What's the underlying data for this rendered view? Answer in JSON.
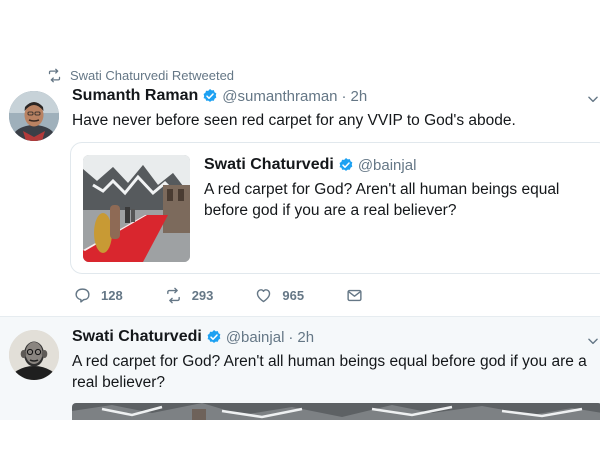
{
  "retweet_context": {
    "icon": "retweet-icon",
    "label": "Swati Chaturvedi Retweeted"
  },
  "tweet1": {
    "author_name": "Sumanth Raman",
    "handle": "@sumanthraman",
    "separator": "·",
    "time": "2h",
    "text": "Have never before seen red carpet for any VVIP to God's abode.",
    "quote": {
      "author_name": "Swati Chaturvedi",
      "handle": "@bainjal",
      "text": "A red carpet for God? Aren't all human beings equal before god if you are a real believer?"
    },
    "actions": {
      "replies": "128",
      "retweets": "293",
      "likes": "965"
    }
  },
  "tweet2": {
    "author_name": "Swati Chaturvedi",
    "handle": "@bainjal",
    "separator": "·",
    "time": "2h",
    "text": "A red carpet for God? Aren't all human beings equal before god if you are a real believer?"
  },
  "colors": {
    "verified": "#1da1f2",
    "muted": "#657786",
    "text": "#14171a",
    "border": "#e1e8ed",
    "carpet": "#d9262e"
  }
}
